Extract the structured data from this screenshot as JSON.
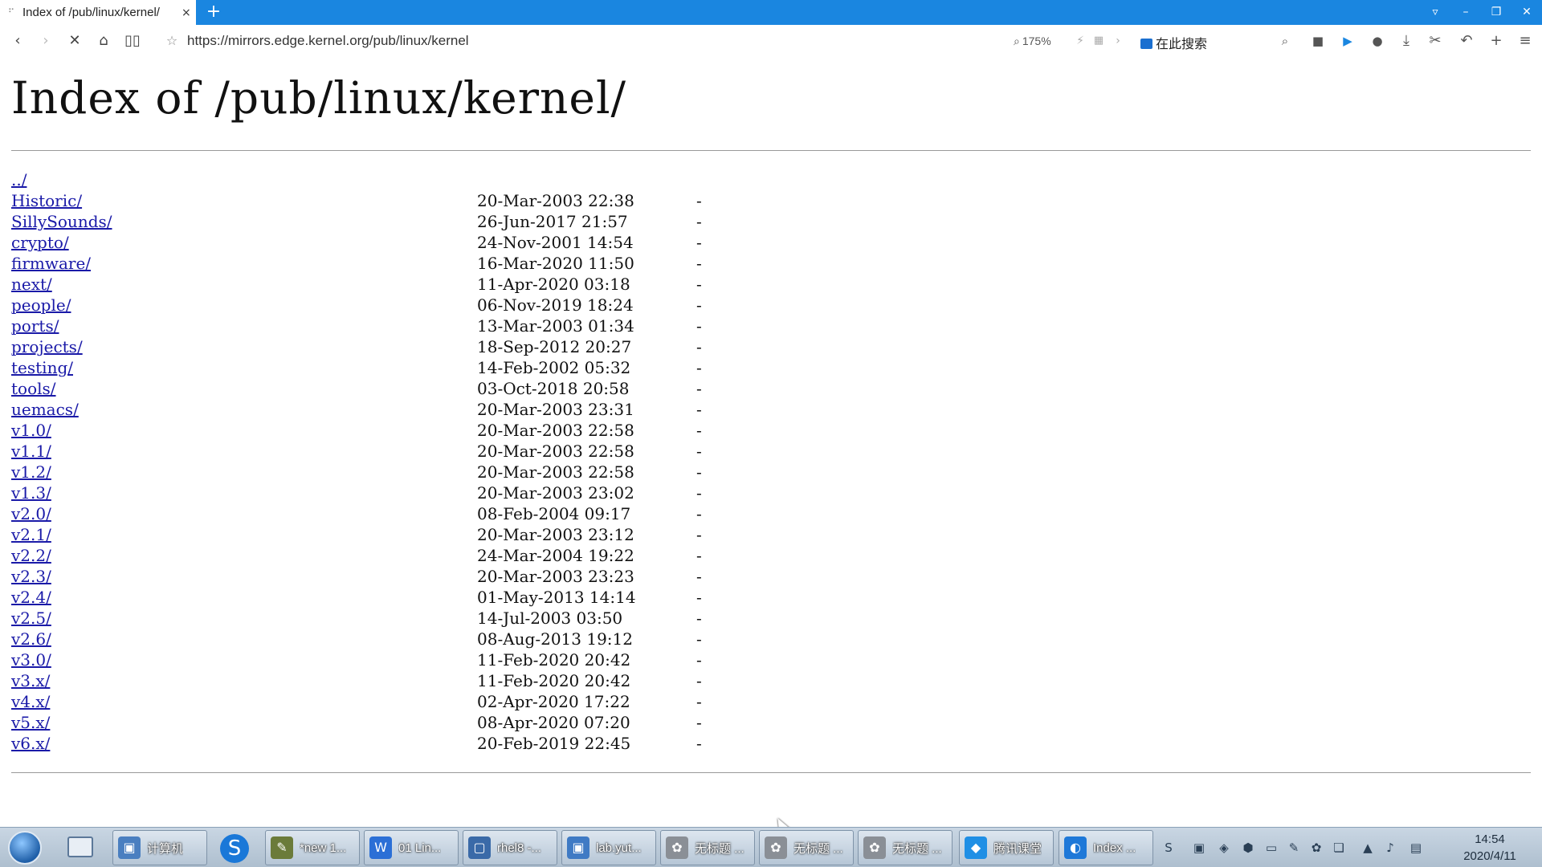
{
  "browser": {
    "tab_title": "Index of /pub/linux/kernel/",
    "tab_close": "×",
    "new_tab": "+",
    "url": "https://mirrors.edge.kernel.org/pub/linux/kernel",
    "zoom": "175%",
    "search_placeholder": "在此搜索"
  },
  "page": {
    "title": "Index of /pub/linux/kernel/",
    "entries": [
      {
        "name": "../",
        "date": "",
        "size": ""
      },
      {
        "name": "Historic/",
        "date": "20-Mar-2003 22:38",
        "size": "-"
      },
      {
        "name": "SillySounds/",
        "date": "26-Jun-2017 21:57",
        "size": "-"
      },
      {
        "name": "crypto/",
        "date": "24-Nov-2001 14:54",
        "size": "-"
      },
      {
        "name": "firmware/",
        "date": "16-Mar-2020 11:50",
        "size": "-"
      },
      {
        "name": "next/",
        "date": "11-Apr-2020 03:18",
        "size": "-"
      },
      {
        "name": "people/",
        "date": "06-Nov-2019 18:24",
        "size": "-"
      },
      {
        "name": "ports/",
        "date": "13-Mar-2003 01:34",
        "size": "-"
      },
      {
        "name": "projects/",
        "date": "18-Sep-2012 20:27",
        "size": "-"
      },
      {
        "name": "testing/",
        "date": "14-Feb-2002 05:32",
        "size": "-"
      },
      {
        "name": "tools/",
        "date": "03-Oct-2018 20:58",
        "size": "-"
      },
      {
        "name": "uemacs/",
        "date": "20-Mar-2003 23:31",
        "size": "-"
      },
      {
        "name": "v1.0/",
        "date": "20-Mar-2003 22:58",
        "size": "-"
      },
      {
        "name": "v1.1/",
        "date": "20-Mar-2003 22:58",
        "size": "-"
      },
      {
        "name": "v1.2/",
        "date": "20-Mar-2003 22:58",
        "size": "-"
      },
      {
        "name": "v1.3/",
        "date": "20-Mar-2003 23:02",
        "size": "-"
      },
      {
        "name": "v2.0/",
        "date": "08-Feb-2004 09:17",
        "size": "-"
      },
      {
        "name": "v2.1/",
        "date": "20-Mar-2003 23:12",
        "size": "-"
      },
      {
        "name": "v2.2/",
        "date": "24-Mar-2004 19:22",
        "size": "-"
      },
      {
        "name": "v2.3/",
        "date": "20-Mar-2003 23:23",
        "size": "-"
      },
      {
        "name": "v2.4/",
        "date": "01-May-2013 14:14",
        "size": "-"
      },
      {
        "name": "v2.5/",
        "date": "14-Jul-2003 03:50",
        "size": "-"
      },
      {
        "name": "v2.6/",
        "date": "08-Aug-2013 19:12",
        "size": "-"
      },
      {
        "name": "v3.0/",
        "date": "11-Feb-2020 20:42",
        "size": "-"
      },
      {
        "name": "v3.x/",
        "date": "11-Feb-2020 20:42",
        "size": "-"
      },
      {
        "name": "v4.x/",
        "date": "02-Apr-2020 17:22",
        "size": "-"
      },
      {
        "name": "v5.x/",
        "date": "08-Apr-2020 07:20",
        "size": "-"
      },
      {
        "name": "v6.x/",
        "date": "20-Feb-2019 22:45",
        "size": "-"
      }
    ]
  },
  "taskbar": {
    "tasks": [
      {
        "label": "计算机",
        "icon": "computer-icon",
        "color": "#4a7fc0"
      },
      {
        "label": "*new 1...",
        "icon": "notepad-icon",
        "color": "#6b7b3a"
      },
      {
        "label": "01 Lin...",
        "icon": "word-icon",
        "color": "#2b6fd6"
      },
      {
        "label": "rhel8 -...",
        "icon": "vm-icon",
        "color": "#3a6aa8"
      },
      {
        "label": "lab.yut...",
        "icon": "remote-icon",
        "color": "#3f7ac4"
      },
      {
        "label": "无标题 ...",
        "icon": "paint-icon",
        "color": "#8a8f96"
      },
      {
        "label": "无标题 ...",
        "icon": "paint-icon",
        "color": "#8a8f96"
      },
      {
        "label": "无标题 ...",
        "icon": "paint-icon",
        "color": "#8a8f96"
      },
      {
        "label": "腾讯课堂",
        "icon": "tencent-classroom-icon",
        "color": "#1f8fe5"
      },
      {
        "label": "Index ...",
        "icon": "browser-icon",
        "color": "#1e78d8"
      }
    ],
    "clock_time": "14:54",
    "clock_date": "2020/4/11"
  },
  "colors": {
    "titlebar": "#1a86e0",
    "link": "#1a1aa8"
  }
}
